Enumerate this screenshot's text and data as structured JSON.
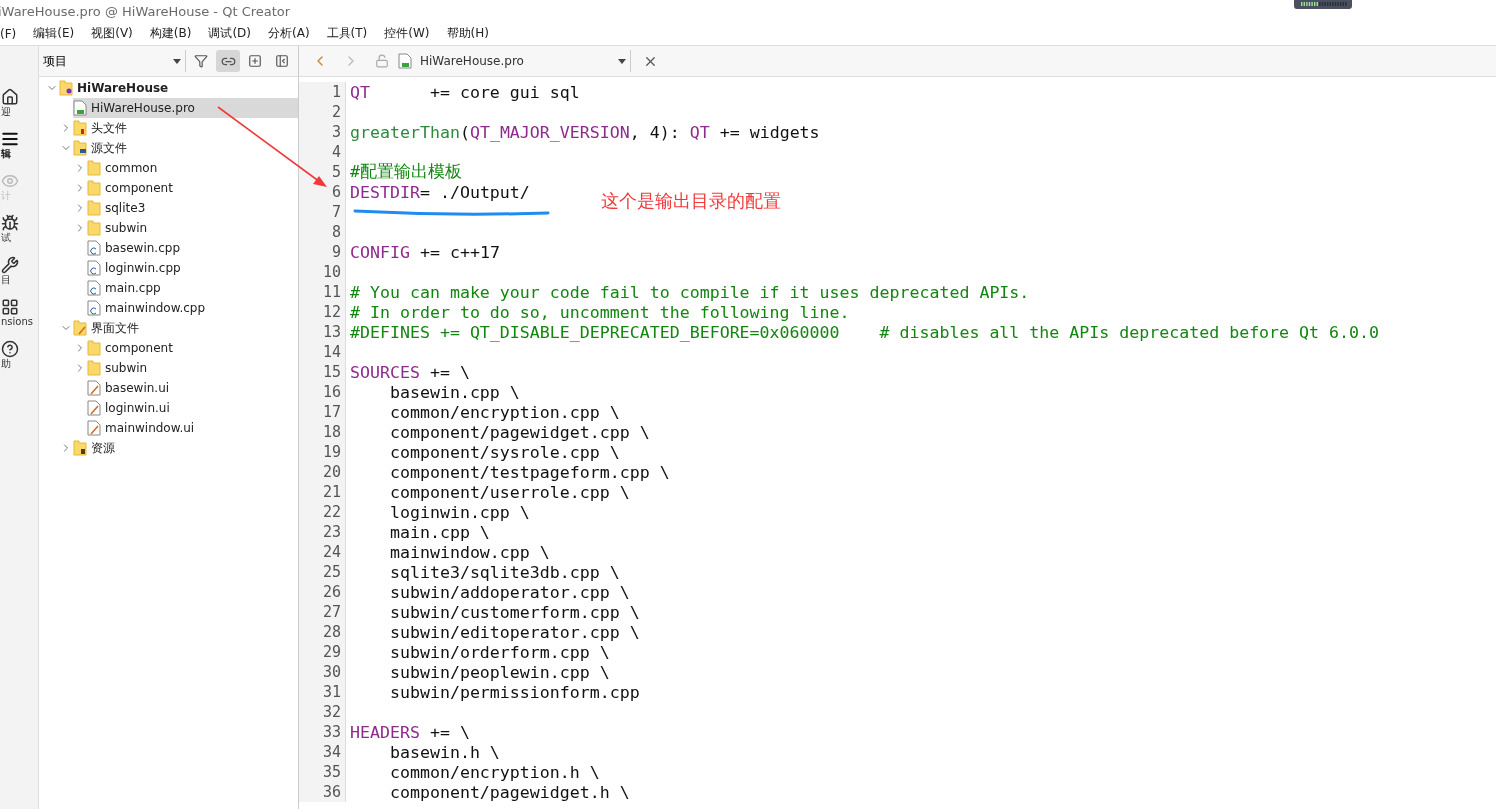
{
  "window": {
    "title": "iWareHouse.pro @ HiWareHouse - Qt Creator"
  },
  "menu": [
    "(F)",
    "编辑(E)",
    "视图(V)",
    "构建(B)",
    "调试(D)",
    "分析(A)",
    "工具(T)",
    "控件(W)",
    "帮助(H)"
  ],
  "mode_rail": [
    {
      "kind": "home",
      "label": "迎",
      "selected": false,
      "disabled": false
    },
    {
      "kind": "edit",
      "label": "辑",
      "selected": true,
      "disabled": false
    },
    {
      "kind": "design",
      "label": "计",
      "selected": false,
      "disabled": true
    },
    {
      "kind": "debug",
      "label": "试",
      "selected": false,
      "disabled": false
    },
    {
      "kind": "project",
      "label": "目",
      "selected": false,
      "disabled": false
    },
    {
      "kind": "extensions",
      "label": "nsions",
      "selected": false,
      "disabled": false
    },
    {
      "kind": "help",
      "label": "助",
      "selected": false,
      "disabled": false
    }
  ],
  "project_panel": {
    "view": "项目",
    "sync_on": true,
    "tree": [
      {
        "label": "HiWareHouse",
        "kind": "project",
        "expanded": true,
        "selected": false,
        "children": [
          {
            "label": "HiWareHouse.pro",
            "kind": "pro",
            "selected": true
          },
          {
            "label": "头文件",
            "kind": "headers",
            "expanded": false,
            "selected": false
          },
          {
            "label": "源文件",
            "kind": "sources",
            "expanded": true,
            "selected": false,
            "children": [
              {
                "label": "common",
                "kind": "folder",
                "expanded": false,
                "selected": false
              },
              {
                "label": "component",
                "kind": "folder",
                "expanded": false,
                "selected": false
              },
              {
                "label": "sqlite3",
                "kind": "folder",
                "expanded": false,
                "selected": false
              },
              {
                "label": "subwin",
                "kind": "folder",
                "expanded": false,
                "selected": false
              },
              {
                "label": "basewin.cpp",
                "kind": "cpp",
                "selected": false
              },
              {
                "label": "loginwin.cpp",
                "kind": "cpp",
                "selected": false
              },
              {
                "label": "main.cpp",
                "kind": "cpp",
                "selected": false
              },
              {
                "label": "mainwindow.cpp",
                "kind": "cpp",
                "selected": false
              }
            ]
          },
          {
            "label": "界面文件",
            "kind": "forms",
            "expanded": true,
            "selected": false,
            "children": [
              {
                "label": "component",
                "kind": "folder",
                "expanded": false,
                "selected": false
              },
              {
                "label": "subwin",
                "kind": "folder",
                "expanded": false,
                "selected": false
              },
              {
                "label": "basewin.ui",
                "kind": "ui",
                "selected": false
              },
              {
                "label": "loginwin.ui",
                "kind": "ui",
                "selected": false
              },
              {
                "label": "mainwindow.ui",
                "kind": "ui",
                "selected": false
              }
            ]
          },
          {
            "label": "资源",
            "kind": "resources",
            "expanded": false,
            "selected": false
          }
        ]
      }
    ]
  },
  "editor": {
    "file": "HiWareHouse.pro",
    "back_enabled": true,
    "forward_enabled": false,
    "lines": [
      {
        "num": "1",
        "segments": [
          {
            "kind": "kw",
            "text": "QT"
          },
          {
            "kind": "plain",
            "text": "      += core gui sql"
          }
        ]
      },
      {
        "num": "2"
      },
      {
        "num": "3",
        "segments": [
          {
            "kind": "fn",
            "text": "greaterThan"
          },
          {
            "kind": "plain",
            "text": "("
          },
          {
            "kind": "kw",
            "text": "QT_MAJOR_VERSION"
          },
          {
            "kind": "plain",
            "text": ", 4): "
          },
          {
            "kind": "kw",
            "text": "QT"
          },
          {
            "kind": "plain",
            "text": " += widgets"
          }
        ]
      },
      {
        "num": "4"
      },
      {
        "num": "5",
        "segments": [
          {
            "kind": "comment",
            "text": "#配置输出模板"
          }
        ]
      },
      {
        "num": "6",
        "segments": [
          {
            "kind": "kw",
            "text": "DESTDIR"
          },
          {
            "kind": "plain",
            "text": "= ./Output/"
          }
        ]
      },
      {
        "num": "7"
      },
      {
        "num": "8"
      },
      {
        "num": "9",
        "segments": [
          {
            "kind": "kw",
            "text": "CONFIG"
          },
          {
            "kind": "plain",
            "text": " += c++17"
          }
        ]
      },
      {
        "num": "10"
      },
      {
        "num": "11",
        "segments": [
          {
            "kind": "comment",
            "text": "# You can make your code fail to compile if it uses deprecated APIs."
          }
        ]
      },
      {
        "num": "12",
        "segments": [
          {
            "kind": "comment",
            "text": "# In order to do so, uncomment the following line."
          }
        ]
      },
      {
        "num": "13",
        "segments": [
          {
            "kind": "comment",
            "text": "#DEFINES += QT_DISABLE_DEPRECATED_BEFORE=0x060000    # disables all the APIs deprecated before Qt 6.0.0"
          }
        ]
      },
      {
        "num": "14"
      },
      {
        "num": "15",
        "segments": [
          {
            "kind": "kw",
            "text": "SOURCES"
          },
          {
            "kind": "plain",
            "text": " += \\"
          }
        ]
      },
      {
        "num": "16",
        "segments": [
          {
            "kind": "plain",
            "text": "    basewin.cpp \\"
          }
        ]
      },
      {
        "num": "17",
        "segments": [
          {
            "kind": "plain",
            "text": "    common/encryption.cpp \\"
          }
        ]
      },
      {
        "num": "18",
        "segments": [
          {
            "kind": "plain",
            "text": "    component/pagewidget.cpp \\"
          }
        ]
      },
      {
        "num": "19",
        "segments": [
          {
            "kind": "plain",
            "text": "    component/sysrole.cpp \\"
          }
        ]
      },
      {
        "num": "20",
        "segments": [
          {
            "kind": "plain",
            "text": "    component/testpageform.cpp \\"
          }
        ]
      },
      {
        "num": "21",
        "segments": [
          {
            "kind": "plain",
            "text": "    component/userrole.cpp \\"
          }
        ]
      },
      {
        "num": "22",
        "segments": [
          {
            "kind": "plain",
            "text": "    loginwin.cpp \\"
          }
        ]
      },
      {
        "num": "23",
        "segments": [
          {
            "kind": "plain",
            "text": "    main.cpp \\"
          }
        ]
      },
      {
        "num": "24",
        "segments": [
          {
            "kind": "plain",
            "text": "    mainwindow.cpp \\"
          }
        ]
      },
      {
        "num": "25",
        "segments": [
          {
            "kind": "plain",
            "text": "    sqlite3/sqlite3db.cpp \\"
          }
        ]
      },
      {
        "num": "26",
        "segments": [
          {
            "kind": "plain",
            "text": "    subwin/addoperator.cpp \\"
          }
        ]
      },
      {
        "num": "27",
        "segments": [
          {
            "kind": "plain",
            "text": "    subwin/customerform.cpp \\"
          }
        ]
      },
      {
        "num": "28",
        "segments": [
          {
            "kind": "plain",
            "text": "    subwin/editoperator.cpp \\"
          }
        ]
      },
      {
        "num": "29",
        "segments": [
          {
            "kind": "plain",
            "text": "    subwin/orderform.cpp \\"
          }
        ]
      },
      {
        "num": "30",
        "segments": [
          {
            "kind": "plain",
            "text": "    subwin/peoplewin.cpp \\"
          }
        ]
      },
      {
        "num": "31",
        "segments": [
          {
            "kind": "plain",
            "text": "    subwin/permissionform.cpp"
          }
        ]
      },
      {
        "num": "32"
      },
      {
        "num": "33",
        "segments": [
          {
            "kind": "kw",
            "text": "HEADERS"
          },
          {
            "kind": "plain",
            "text": " += \\"
          }
        ]
      },
      {
        "num": "34",
        "segments": [
          {
            "kind": "plain",
            "text": "    basewin.h \\"
          }
        ]
      },
      {
        "num": "35",
        "segments": [
          {
            "kind": "plain",
            "text": "    common/encryption.h \\"
          }
        ]
      },
      {
        "num": "36",
        "segments": [
          {
            "kind": "plain",
            "text": "    component/pagewidget.h \\"
          }
        ]
      }
    ]
  },
  "annotation": {
    "text": "这个是输出目录的配置"
  }
}
